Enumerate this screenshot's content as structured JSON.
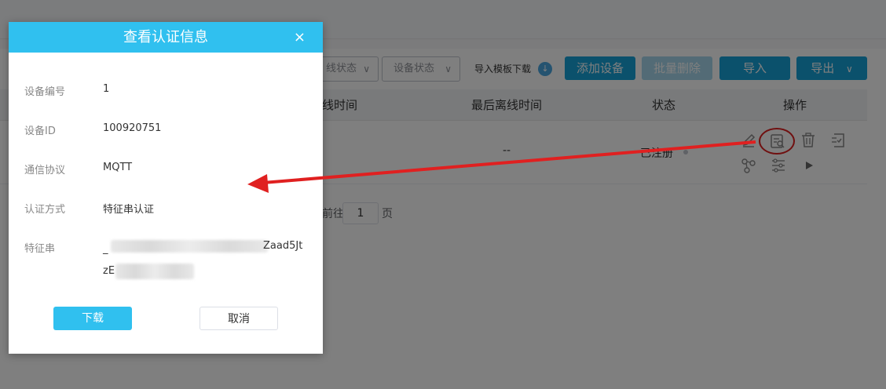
{
  "page": {
    "filters": [
      {
        "label": "线状态"
      },
      {
        "label": "设备状态"
      }
    ],
    "template_link": "导入模板下载",
    "buttons": {
      "add": "添加设备",
      "batch_delete": "批量删除",
      "import": "导入",
      "export": "导出"
    },
    "table": {
      "headers": [
        "线时间",
        "最后离线时间",
        "状态",
        "操作"
      ],
      "row": {
        "last_offline": "--",
        "status": "已注册"
      }
    },
    "pager": {
      "goto_label": "前往",
      "page": "1",
      "page_suffix": "页"
    }
  },
  "dialog": {
    "title": "查看认证信息",
    "close_glyph": "×",
    "fields": [
      {
        "label": "设备编号",
        "value": "1"
      },
      {
        "label": "设备ID",
        "value": "100920751"
      },
      {
        "label": "通信协议",
        "value": "MQTT"
      },
      {
        "label": "认证方式",
        "value": "特征串认证"
      },
      {
        "label": "特征串",
        "value_line1_prefix": "_",
        "value_line1_suffix": "Zaad5Jt",
        "value_line2_prefix": "zE"
      }
    ],
    "download_label": "下载",
    "cancel_label": "取消"
  },
  "colors": {
    "dialog_header": "#30c0ef",
    "primary_button": "#16a3d9",
    "disabled_button": "#a6d7ec",
    "annotation_red": "#e02020"
  },
  "icons": [
    "edit-icon",
    "view-auth-icon",
    "delete-icon",
    "checklist-icon",
    "topology-icon",
    "settings-sliders-icon",
    "play-icon",
    "close-icon",
    "download-circle-icon",
    "chevron-down-icon"
  ]
}
